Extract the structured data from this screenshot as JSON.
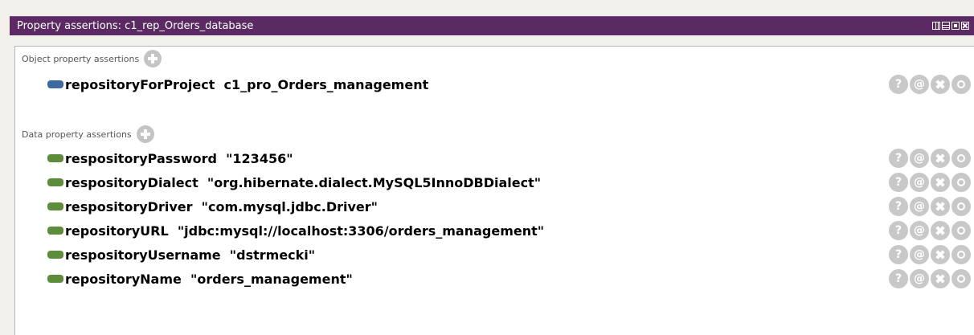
{
  "window": {
    "title": "Property assertions: c1_rep_Orders_database",
    "titlebar_color": "#5b2a63"
  },
  "colors": {
    "object_property_chip": "#3d6b9e",
    "data_property_chip": "#5e8c3a",
    "action_button": "#c8c8c8"
  },
  "action_labels": {
    "explain": "?",
    "annotate": "@"
  },
  "sections": {
    "object": {
      "label": "Object property assertions",
      "add_icon": "add-circle-icon",
      "items": [
        {
          "property": "repositoryForProject",
          "value": "c1_pro_Orders_management"
        }
      ]
    },
    "data": {
      "label": "Data property assertions",
      "add_icon": "add-circle-icon",
      "items": [
        {
          "property": "respositoryPassword",
          "value": "\"123456\""
        },
        {
          "property": "respositoryDialect",
          "value": "\"org.hibernate.dialect.MySQL5InnoDBDialect\""
        },
        {
          "property": "respositoryDriver",
          "value": "\"com.mysql.jdbc.Driver\""
        },
        {
          "property": "repositoryURL",
          "value": "\"jdbc:mysql://localhost:3306/orders_management\""
        },
        {
          "property": "respositoryUsername",
          "value": "\"dstrmecki\""
        },
        {
          "property": "repositoryName",
          "value": "\"orders_management\""
        }
      ]
    }
  }
}
